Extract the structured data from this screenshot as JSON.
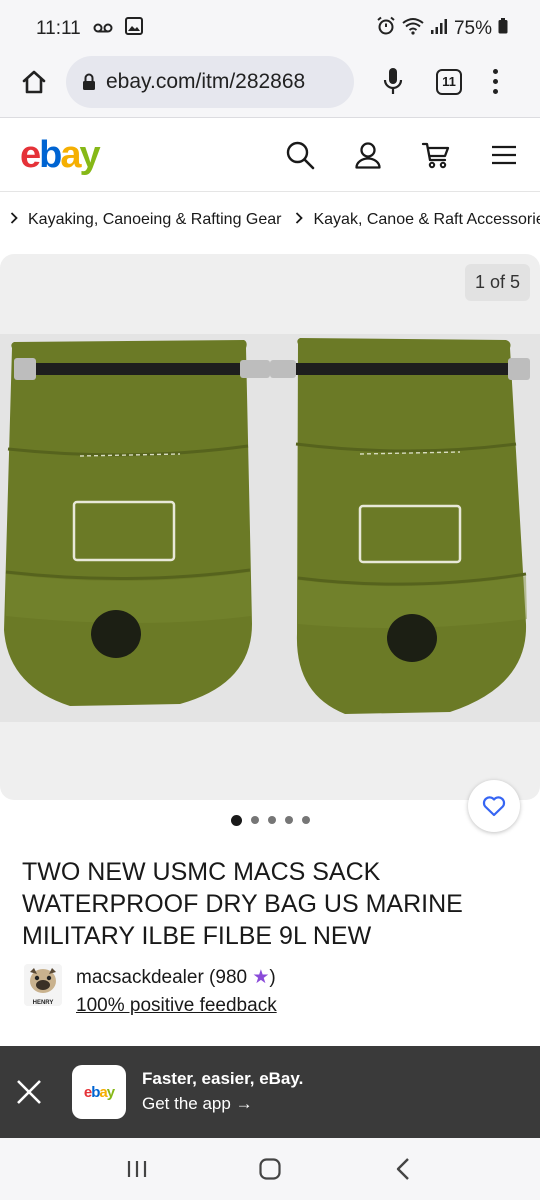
{
  "status_bar": {
    "time": "11:11",
    "battery": "75%"
  },
  "browser": {
    "url": "ebay.com/itm/282868",
    "tab_count": "11"
  },
  "ebay": {
    "logo": {
      "e": "e",
      "b": "b",
      "a": "a",
      "y": "y"
    }
  },
  "breadcrumb": {
    "items": [
      "Kayaking, Canoeing & Rafting Gear",
      "Kayak, Canoe & Raft Accessories"
    ]
  },
  "gallery": {
    "counter": "1 of 5",
    "image_count": 5,
    "active_index": 0
  },
  "listing": {
    "title": "TWO NEW USMC MACS SACK WATERPROOF DRY BAG US MARINE MILITARY ILBE FILBE 9L NEW",
    "seller_name": "macsackdealer (980",
    "seller_star": "★",
    "seller_close": ")",
    "feedback": "100% positive feedback",
    "avatar_label": "HENRY"
  },
  "app_banner": {
    "icon_text": {
      "e": "e",
      "b": "b",
      "a": "a",
      "y": "y"
    },
    "title": "Faster, easier, eBay.",
    "cta": "Get the app →"
  },
  "colors": {
    "ebay_red": "#e53238",
    "ebay_blue": "#0064d2",
    "ebay_yellow": "#f5af02",
    "ebay_green": "#86b817",
    "bag_green": "#6b7a26",
    "favorite_blue": "#3665f3"
  }
}
